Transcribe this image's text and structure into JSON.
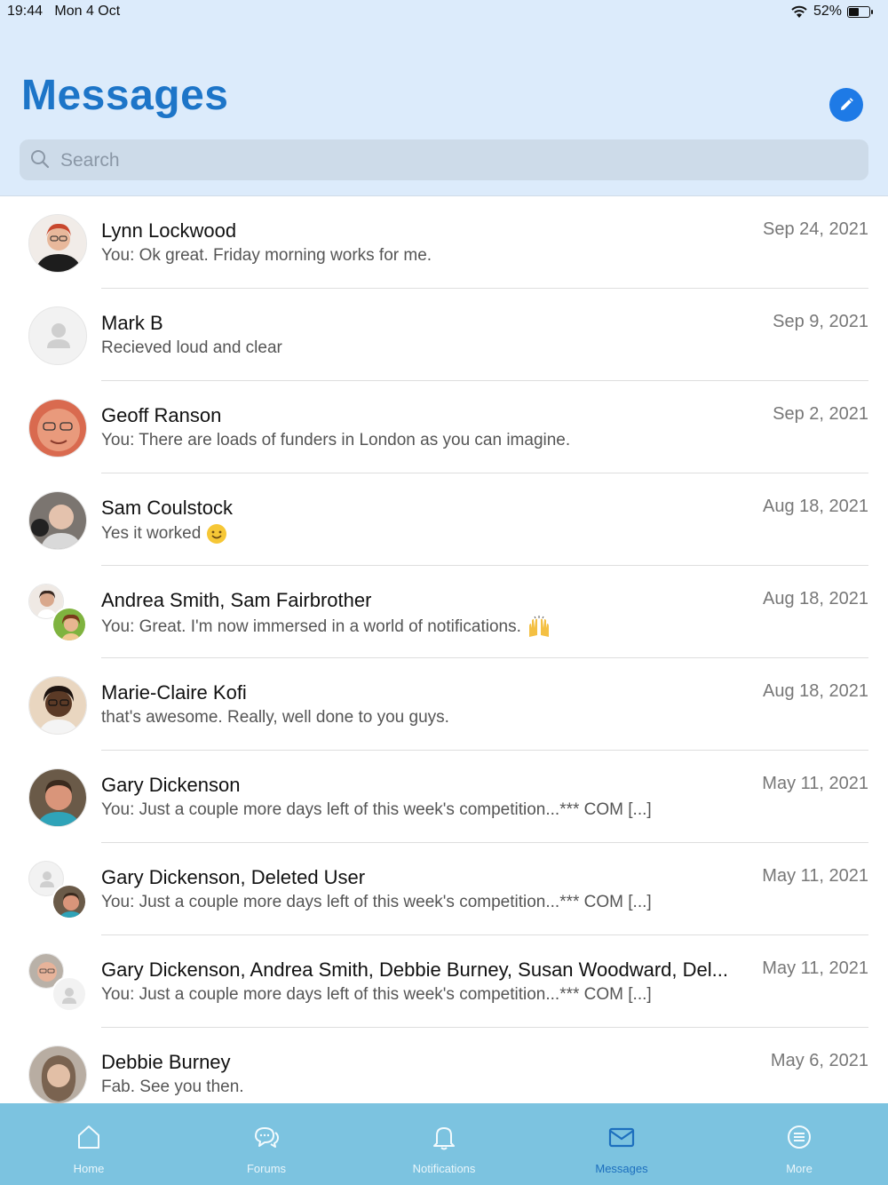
{
  "status_bar": {
    "time": "19:44",
    "date": "Mon 4 Oct",
    "battery": "52%",
    "battery_level": 0.52
  },
  "header": {
    "title": "Messages",
    "search_placeholder": "Search"
  },
  "conversations": [
    {
      "name": "Lynn Lockwood",
      "preview": "You:  Ok great. Friday morning works for me.",
      "date": "Sep 24, 2021"
    },
    {
      "name": "Mark B",
      "preview": "Recieved loud and clear",
      "date": "Sep 9, 2021"
    },
    {
      "name": "Geoff Ranson",
      "preview": "You:  There are loads of funders in London as you can imagine.",
      "date": "Sep 2, 2021"
    },
    {
      "name": "Sam Coulstock",
      "preview": "Yes it worked",
      "date": "Aug 18, 2021"
    },
    {
      "name": "Andrea Smith, Sam Fairbrother",
      "preview": "You:  Great. I'm now immersed in a world of notifications.",
      "date": "Aug 18, 2021"
    },
    {
      "name": "Marie-Claire Kofi",
      "preview": "that's awesome. Really, well done to you guys.",
      "date": "Aug 18, 2021"
    },
    {
      "name": "Gary Dickenson",
      "preview": "You:  Just a couple more days left of this week's competition...*** COM [...]",
      "date": "May 11, 2021"
    },
    {
      "name": "Gary Dickenson, Deleted User",
      "preview": "You:  Just a couple more days left of this week's competition...*** COM [...]",
      "date": "May 11, 2021"
    },
    {
      "name": "Gary Dickenson, Andrea Smith, Debbie Burney, Susan Woodward, Del...",
      "preview": "You:  Just a couple more days left of this week's competition...*** COM [...]",
      "date": "May 11, 2021"
    },
    {
      "name": "Debbie Burney",
      "preview": "Fab. See you then.",
      "date": "May 6, 2021"
    }
  ],
  "tabbar": {
    "home": "Home",
    "forums": "Forums",
    "notifications": "Notifications",
    "messages": "Messages",
    "more": "More"
  },
  "colors": {
    "header_bg": "#dcebfb",
    "title": "#1d75c8",
    "compose_button": "#1e7ae6",
    "tabbar_bg": "#7cc3e0",
    "tab_active": "#1d6fbe"
  }
}
